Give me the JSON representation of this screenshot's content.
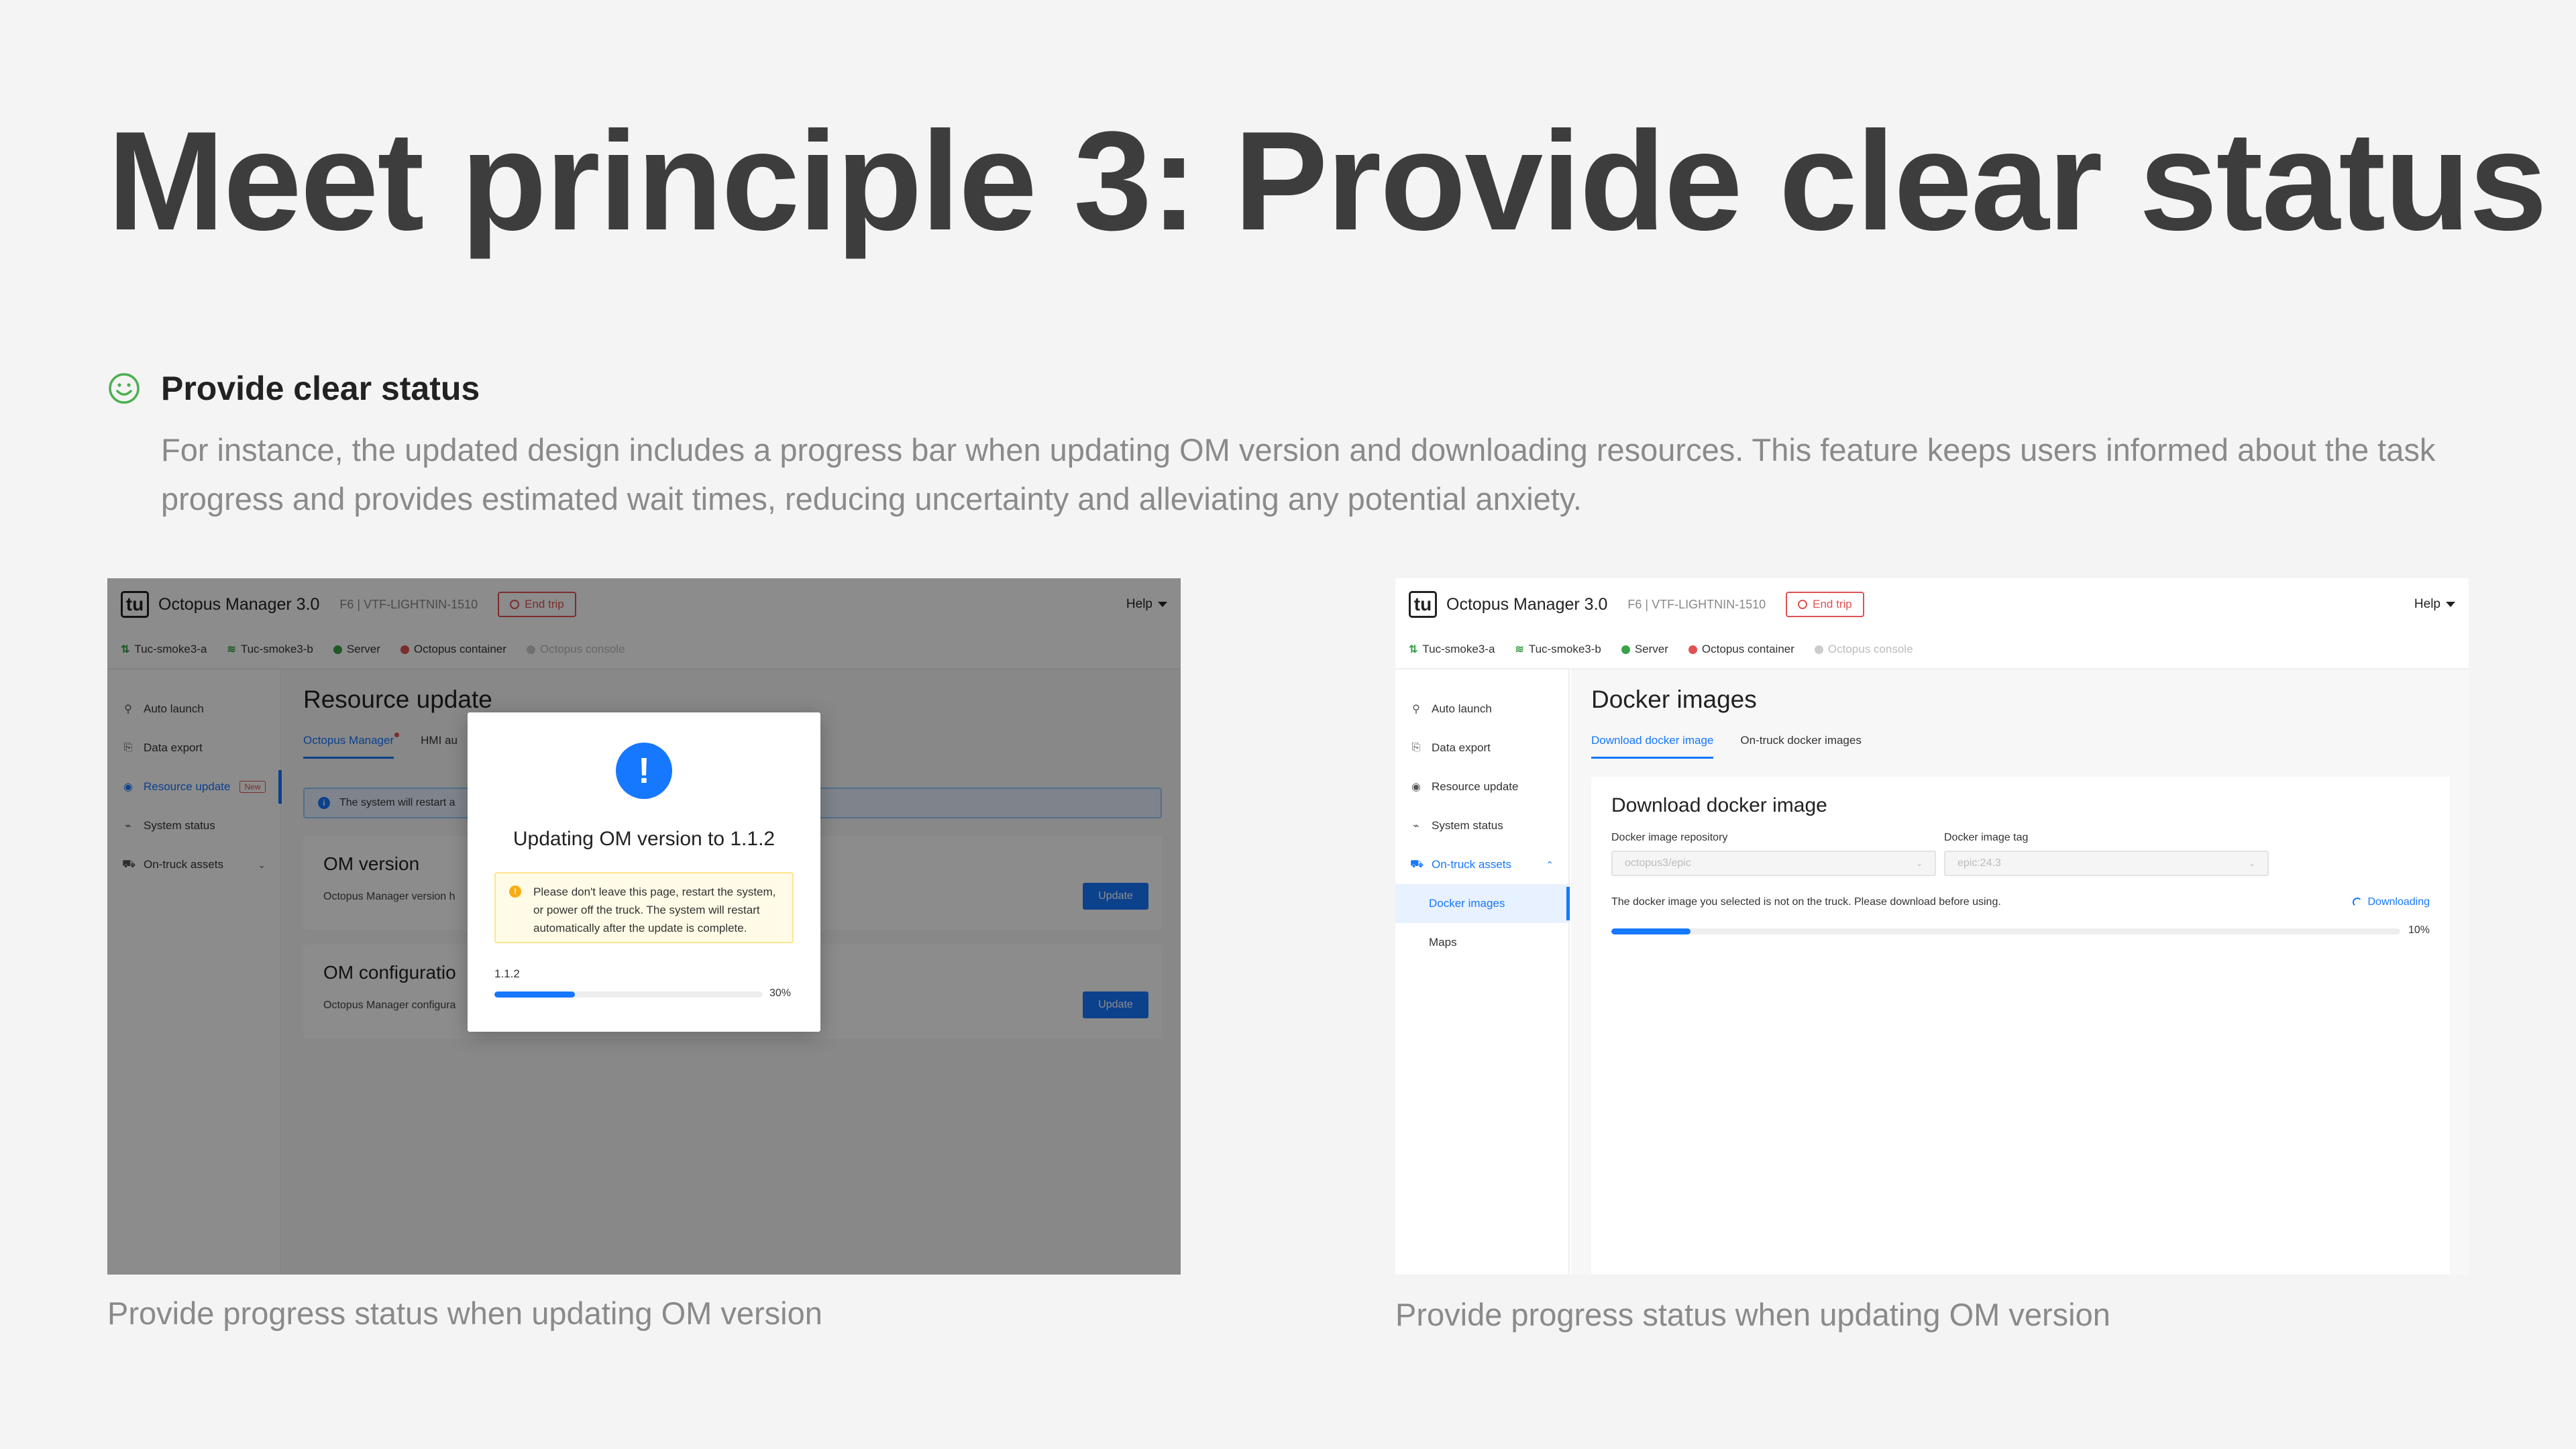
{
  "slide": {
    "title": "Meet principle 3: Provide clear status",
    "principle_heading": "Provide clear status",
    "principle_desc": "For instance, the updated design includes a progress bar when updating OM version and downloading resources. This feature keeps users informed about the task progress and provides estimated wait times, reducing uncertainty and alleviating any potential anxiety.",
    "caption_left": "Provide progress status when updating OM version",
    "caption_right": "Provide progress status when updating OM version",
    "icon": "smile-icon",
    "accent_green": "#4caf50"
  },
  "app": {
    "logo": "tu",
    "name": "Octopus Manager 3.0",
    "trip": "F6 | VTF-LIGHTNIN-1510",
    "end_trip": "End trip",
    "help": "Help",
    "accent": "#1677ff",
    "danger": "#e05252",
    "status": [
      {
        "label": "Tuc-smoke3-a",
        "kind": "signal",
        "color": "#3aa34a"
      },
      {
        "label": "Tuc-smoke3-b",
        "kind": "wifi",
        "color": "#3aa34a"
      },
      {
        "label": "Server",
        "kind": "dot",
        "color": "#3aa34a"
      },
      {
        "label": "Octopus container",
        "kind": "dot",
        "color": "#e05252"
      },
      {
        "label": "Octopus console",
        "kind": "dot",
        "color": "#cccccc"
      }
    ],
    "nav": {
      "auto_launch": "Auto launch",
      "data_export": "Data export",
      "resource_update": "Resource update",
      "new_badge": "New",
      "system_status": "System status",
      "on_truck_assets": "On-truck assets",
      "docker_images": "Docker images",
      "maps": "Maps"
    }
  },
  "left": {
    "page_title": "Resource update",
    "tab_om": "Octopus Manager",
    "tab_hmi": "HMI au",
    "alert": "The system will restart a",
    "card1_title": "OM version",
    "card1_desc": "Octopus Manager version h",
    "card2_title": "OM configuratio",
    "card2_desc": "Octopus Manager configura",
    "update": "Update",
    "modal": {
      "title": "Updating OM version to 1.1.2",
      "warning": "Please don't leave this page, restart the system, or power off the truck. The system will restart automatically after the update is complete.",
      "version": "1.1.2",
      "progress": 0.3,
      "progress_label": "30%"
    }
  },
  "right": {
    "page_title": "Docker images",
    "tab_download": "Download docker image",
    "tab_on_truck": "On-truck docker images",
    "panel_title": "Download docker image",
    "repo_label": "Docker image repository",
    "repo_value": "octopus3/epic",
    "tag_label": "Docker image tag",
    "tag_value": "epic:24.3",
    "message": "The docker image you selected is not on the truck. Please download before using.",
    "downloading": "Downloading",
    "progress": 0.1,
    "progress_label": "10%"
  }
}
